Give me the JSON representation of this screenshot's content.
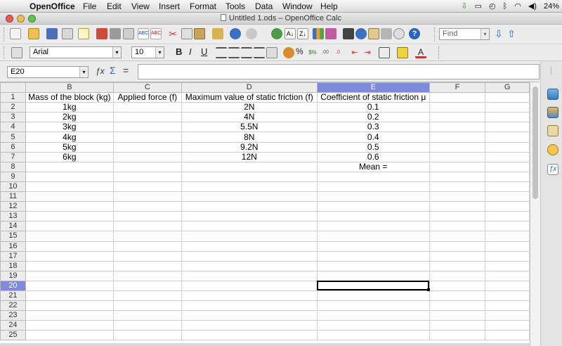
{
  "menubar": {
    "app_name": "OpenOffice",
    "items": [
      "File",
      "Edit",
      "View",
      "Insert",
      "Format",
      "Tools",
      "Data",
      "Window",
      "Help"
    ],
    "battery": "24%"
  },
  "window": {
    "title": "Untitled 1.ods – OpenOffice Calc"
  },
  "toolbar": {
    "find_placeholder": "Find"
  },
  "format_toolbar": {
    "font_name": "Arial",
    "font_size": "10",
    "bold": "B",
    "italic": "I",
    "underline": "U",
    "percent": "%"
  },
  "formula_bar": {
    "cell_ref": "E20",
    "formula": ""
  },
  "sheet": {
    "columns": [
      "B",
      "C",
      "D",
      "E",
      "F",
      "G"
    ],
    "active_column": "E",
    "active_row": "20",
    "rows": [
      {
        "num": "1",
        "cells": [
          "Mass of the block (kg)",
          "Applied force (f)",
          "Maximum value of static friction (f)",
          "Coefficient of static friction μ",
          "",
          ""
        ]
      },
      {
        "num": "2",
        "cells": [
          "1kg",
          "",
          "2N",
          "0.1",
          "",
          ""
        ]
      },
      {
        "num": "3",
        "cells": [
          "2kg",
          "",
          "4N",
          "0.2",
          "",
          ""
        ]
      },
      {
        "num": "4",
        "cells": [
          "3kg",
          "",
          "5.5N",
          "0.3",
          "",
          ""
        ]
      },
      {
        "num": "5",
        "cells": [
          "4kg",
          "",
          "8N",
          "0.4",
          "",
          ""
        ]
      },
      {
        "num": "6",
        "cells": [
          "5kg",
          "",
          "9.2N",
          "0.5",
          "",
          ""
        ]
      },
      {
        "num": "7",
        "cells": [
          "6kg",
          "",
          "12N",
          "0.6",
          "",
          ""
        ]
      },
      {
        "num": "8",
        "cells": [
          "",
          "",
          "",
          "Mean =",
          "",
          ""
        ]
      },
      {
        "num": "9",
        "cells": [
          "",
          "",
          "",
          "",
          "",
          ""
        ]
      },
      {
        "num": "10",
        "cells": [
          "",
          "",
          "",
          "",
          "",
          ""
        ]
      },
      {
        "num": "11",
        "cells": [
          "",
          "",
          "",
          "",
          "",
          ""
        ]
      },
      {
        "num": "12",
        "cells": [
          "",
          "",
          "",
          "",
          "",
          ""
        ]
      },
      {
        "num": "13",
        "cells": [
          "",
          "",
          "",
          "",
          "",
          ""
        ]
      },
      {
        "num": "14",
        "cells": [
          "",
          "",
          "",
          "",
          "",
          ""
        ]
      },
      {
        "num": "15",
        "cells": [
          "",
          "",
          "",
          "",
          "",
          ""
        ]
      },
      {
        "num": "16",
        "cells": [
          "",
          "",
          "",
          "",
          "",
          ""
        ]
      },
      {
        "num": "17",
        "cells": [
          "",
          "",
          "",
          "",
          "",
          ""
        ]
      },
      {
        "num": "18",
        "cells": [
          "",
          "",
          "",
          "",
          "",
          ""
        ]
      },
      {
        "num": "19",
        "cells": [
          "",
          "",
          "",
          "",
          "",
          ""
        ]
      },
      {
        "num": "20",
        "cells": [
          "",
          "",
          "",
          "",
          "",
          ""
        ]
      },
      {
        "num": "21",
        "cells": [
          "",
          "",
          "",
          "",
          "",
          ""
        ]
      },
      {
        "num": "22",
        "cells": [
          "",
          "",
          "",
          "",
          "",
          ""
        ]
      },
      {
        "num": "23",
        "cells": [
          "",
          "",
          "",
          "",
          "",
          ""
        ]
      },
      {
        "num": "24",
        "cells": [
          "",
          "",
          "",
          "",
          "",
          ""
        ]
      },
      {
        "num": "25",
        "cells": [
          "",
          "",
          "",
          "",
          "",
          ""
        ]
      }
    ]
  },
  "colors": {
    "active_header": "#7e8bd8",
    "selection_border": "#000000",
    "window_bg": "#ececec"
  }
}
